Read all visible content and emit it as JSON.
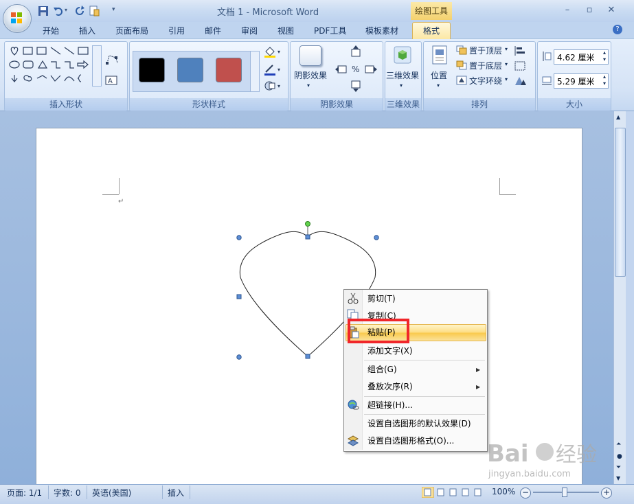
{
  "window": {
    "title": "文档 1 - Microsoft Word",
    "contextual_tool_title": "绘图工具",
    "controls": {
      "minimize": "–",
      "maximize": "▫",
      "close": "✕"
    }
  },
  "tabs": [
    {
      "label": "开始"
    },
    {
      "label": "插入"
    },
    {
      "label": "页面布局"
    },
    {
      "label": "引用"
    },
    {
      "label": "邮件"
    },
    {
      "label": "审阅"
    },
    {
      "label": "视图"
    },
    {
      "label": "PDF工具"
    },
    {
      "label": "模板素材"
    },
    {
      "label": "格式",
      "active": true
    }
  ],
  "ribbon": {
    "groups": {
      "insert_shapes": "插入形状",
      "shape_styles": "形状样式",
      "shadow_effects": "阴影效果",
      "effects_3d": "三维效果",
      "arrange": "排列",
      "size": "大小"
    },
    "shadow_effects_button": "阴影效果",
    "effects_3d_button": "三维效果",
    "position_button": "位置",
    "bring_to_front": "置于顶层",
    "send_to_back": "置于底层",
    "text_wrapping": "文字环绕",
    "height_value": "4.62 厘米",
    "width_value": "5.29 厘米",
    "swatch_colors": [
      "#000000",
      "#4f81bd",
      "#c0504d"
    ]
  },
  "context_menu": {
    "items": [
      {
        "label": "剪切(T)",
        "icon": "scissors-icon"
      },
      {
        "label": "复制(C)",
        "icon": "copy-icon"
      },
      {
        "label": "粘贴(P)",
        "icon": "paste-icon",
        "highlighted": true
      },
      {
        "label": "添加文字(X)"
      },
      {
        "label": "组合(G)",
        "submenu": true
      },
      {
        "label": "叠放次序(R)",
        "submenu": true
      },
      {
        "label": "超链接(H)...",
        "icon": "hyperlink-icon"
      },
      {
        "label": "设置自选图形的默认效果(D)"
      },
      {
        "label": "设置自选图形格式(O)...",
        "icon": "format-shape-icon"
      }
    ]
  },
  "status_bar": {
    "page": "页面: 1/1",
    "words": "字数: 0",
    "language": "英语(美国)",
    "mode": "插入",
    "zoom": "100%"
  },
  "watermark": {
    "brand": "Baidu经验",
    "url": "jingyan.baidu.com"
  },
  "colors": {
    "highlight_border": "#f0262a",
    "menu_highlight": "#fddd82"
  }
}
